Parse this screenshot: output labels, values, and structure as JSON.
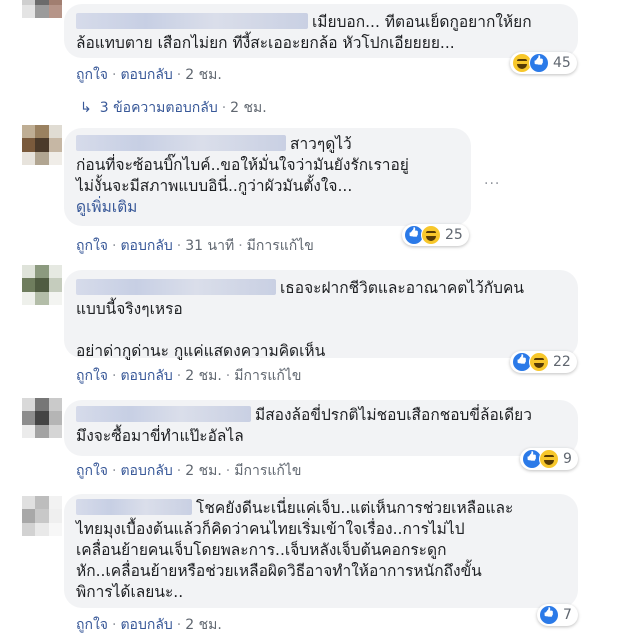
{
  "comments": [
    {
      "text": "เมียบอก... ทีตอนเย็ดกูอยากให้ยก\nล้อแทบตาย เสือกไม่ยก ทีงี้สะเออะยกล้อ หัวโปกเอียยยย...",
      "like_label": "ถูกใจ",
      "reply_label": "ตอบกลับ",
      "time": "2 ชม.",
      "edited": "",
      "reaction_count": "45",
      "reaction_order": [
        "haha",
        "like"
      ]
    },
    {
      "text": "สาวๆดูไว้\nก่อนที่จะซ้อนบิ๊กไบค์..ขอให้มั่นใจว่ามันยังรักเราอยู่\nไม่งั้นจะมีสภาพแบบอินี่..กูว่าผัวมันตั้งใจ...",
      "see_more": "ดูเพิ่มเติม",
      "like_label": "ถูกใจ",
      "reply_label": "ตอบกลับ",
      "time": "31 นาที",
      "edited": "มีการแก้ไข",
      "reaction_count": "25",
      "reaction_order": [
        "like",
        "haha"
      ]
    },
    {
      "text": "เธอจะฝากชีวิตและอาณาคตไว้กับคน\nแบบนี้จริงๆเหรอ\n\nอย่าด่ากูด่านะ กูแค่แสดงความคิดเห็น",
      "like_label": "ถูกใจ",
      "reply_label": "ตอบกลับ",
      "time": "2 ชม.",
      "edited": "มีการแก้ไข",
      "reaction_count": "22",
      "reaction_order": [
        "like",
        "haha"
      ]
    },
    {
      "text": "มีสองล้อขี่ปรกติไม่ชอบเสือกชอบขี่ล้อเดียว\nมึงจะซื้อมาขี่ทำแป๊ะอัลไล",
      "like_label": "ถูกใจ",
      "reply_label": "ตอบกลับ",
      "time": "2 ชม.",
      "edited": "มีการแก้ไข",
      "reaction_count": "9",
      "reaction_order": [
        "like",
        "haha"
      ]
    },
    {
      "text": "โชคยังดีนะเนี่ยแค่เจ็บ..แต่เห็นการช่วยเหลือและ\nไทยมุงเบื้องต้นแล้วก็คิดว่าคนไทยเริ่มเข้าใจเรื่อง..การไม่ไป\nเคลื่อนย้ายคนเจ็บโดยพละการ..เจ็บหลังเจ็บต้นคอกระดูก\nหัก..เคลื่อนย้ายหรือช่วยเหลือผิดวิธีอาจทำให้อาการหนักถึงขั้น\nพิการได้เลยนะ..",
      "like_label": "ถูกใจ",
      "reply_label": "ตอบกลับ",
      "time": "2 ชม.",
      "edited": "",
      "reaction_count": "7",
      "reaction_order": [
        "like"
      ]
    }
  ],
  "replies_link": {
    "label": "3 ข้อความตอบกลับ",
    "time": "2 ชม."
  },
  "more_options": "···",
  "colors": {
    "bubble": "#f2f3f5",
    "link": "#385898",
    "meta": "#606770",
    "like": "#2b7ae8",
    "haha": "#f7c72b"
  }
}
